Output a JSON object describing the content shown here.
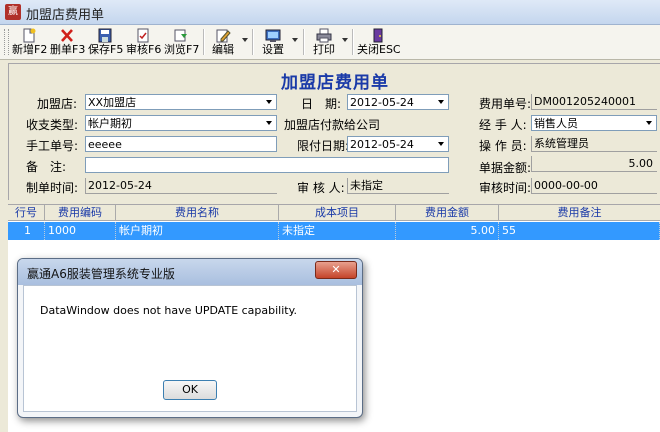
{
  "window": {
    "title": "加盟店费用单"
  },
  "toolbar": {
    "buttons": [
      {
        "label": "新增F2",
        "icon": "new-document-icon"
      },
      {
        "label": "删单F3",
        "icon": "delete-x-icon"
      },
      {
        "label": "保存F5",
        "icon": "save-disk-icon"
      },
      {
        "label": "审核F6",
        "icon": "audit-check-icon"
      },
      {
        "label": "浏览F7",
        "icon": "browse-icon"
      },
      {
        "label": "编辑",
        "icon": "edit-pencil-icon"
      },
      {
        "label": "设置",
        "icon": "settings-icon"
      },
      {
        "label": "打印",
        "icon": "printer-icon"
      },
      {
        "label": "关闭ESC",
        "icon": "close-door-icon"
      }
    ]
  },
  "form": {
    "title": "加盟店费用单",
    "labels": {
      "store": "加盟店:",
      "date": "日　期:",
      "doc_no": "费用单号:",
      "fee_type": "收支类型:",
      "handler": "经 手 人:",
      "manual_no": "手工单号:",
      "deadline": "限付日期:",
      "operator": "操 作 员:",
      "note": "备　注:",
      "amount": "单据金额:",
      "created": "制单时间:",
      "auditor": "审 核 人:",
      "audit_time": "审核时间:"
    },
    "values": {
      "store": "XX加盟店",
      "date": "2012-05-24",
      "doc_no": "DM001205240001",
      "fee_type": "帐户期初",
      "payer": "加盟店付款给公司",
      "handler": "销售人员",
      "manual_no": "eeeee",
      "deadline": "2012-05-24",
      "operator": "系统管理员",
      "note": "",
      "amount": "5.00",
      "created": "2012-05-24",
      "auditor": "未指定",
      "audit_time": "0000-00-00"
    }
  },
  "grid": {
    "headers": [
      "行号",
      "费用编码",
      "费用名称",
      "成本项目",
      "费用金额",
      "费用备注"
    ],
    "rows": [
      {
        "no": "1",
        "code": "1000",
        "name": "帐户期初",
        "cost_item": "未指定",
        "amount": "5.00",
        "remark": "55"
      }
    ]
  },
  "dialog": {
    "title": "赢通A6服装管理系统专业版",
    "message": "DataWindow does not have UPDATE capability.",
    "ok_label": "OK",
    "close_label": "✕"
  }
}
